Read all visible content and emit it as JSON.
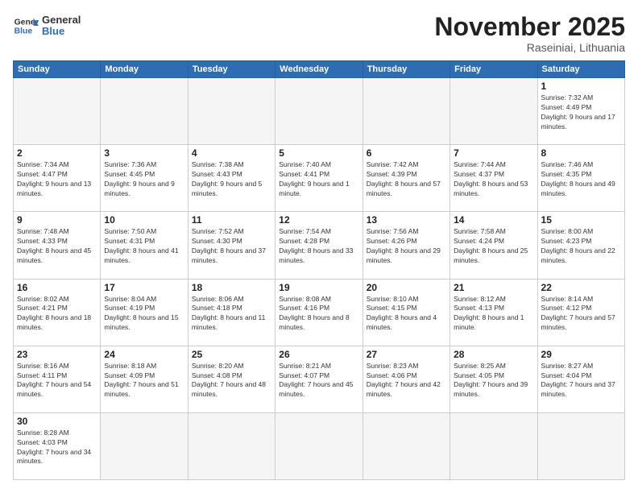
{
  "header": {
    "logo_general": "General",
    "logo_blue": "Blue",
    "month_title": "November 2025",
    "location": "Raseiniai, Lithuania"
  },
  "weekdays": [
    "Sunday",
    "Monday",
    "Tuesday",
    "Wednesday",
    "Thursday",
    "Friday",
    "Saturday"
  ],
  "days": [
    {
      "num": "",
      "info": ""
    },
    {
      "num": "",
      "info": ""
    },
    {
      "num": "",
      "info": ""
    },
    {
      "num": "",
      "info": ""
    },
    {
      "num": "",
      "info": ""
    },
    {
      "num": "",
      "info": ""
    },
    {
      "num": "1",
      "info": "Sunrise: 7:32 AM\nSunset: 4:49 PM\nDaylight: 9 hours and 17 minutes."
    },
    {
      "num": "2",
      "info": "Sunrise: 7:34 AM\nSunset: 4:47 PM\nDaylight: 9 hours and 13 minutes."
    },
    {
      "num": "3",
      "info": "Sunrise: 7:36 AM\nSunset: 4:45 PM\nDaylight: 9 hours and 9 minutes."
    },
    {
      "num": "4",
      "info": "Sunrise: 7:38 AM\nSunset: 4:43 PM\nDaylight: 9 hours and 5 minutes."
    },
    {
      "num": "5",
      "info": "Sunrise: 7:40 AM\nSunset: 4:41 PM\nDaylight: 9 hours and 1 minute."
    },
    {
      "num": "6",
      "info": "Sunrise: 7:42 AM\nSunset: 4:39 PM\nDaylight: 8 hours and 57 minutes."
    },
    {
      "num": "7",
      "info": "Sunrise: 7:44 AM\nSunset: 4:37 PM\nDaylight: 8 hours and 53 minutes."
    },
    {
      "num": "8",
      "info": "Sunrise: 7:46 AM\nSunset: 4:35 PM\nDaylight: 8 hours and 49 minutes."
    },
    {
      "num": "9",
      "info": "Sunrise: 7:48 AM\nSunset: 4:33 PM\nDaylight: 8 hours and 45 minutes."
    },
    {
      "num": "10",
      "info": "Sunrise: 7:50 AM\nSunset: 4:31 PM\nDaylight: 8 hours and 41 minutes."
    },
    {
      "num": "11",
      "info": "Sunrise: 7:52 AM\nSunset: 4:30 PM\nDaylight: 8 hours and 37 minutes."
    },
    {
      "num": "12",
      "info": "Sunrise: 7:54 AM\nSunset: 4:28 PM\nDaylight: 8 hours and 33 minutes."
    },
    {
      "num": "13",
      "info": "Sunrise: 7:56 AM\nSunset: 4:26 PM\nDaylight: 8 hours and 29 minutes."
    },
    {
      "num": "14",
      "info": "Sunrise: 7:58 AM\nSunset: 4:24 PM\nDaylight: 8 hours and 25 minutes."
    },
    {
      "num": "15",
      "info": "Sunrise: 8:00 AM\nSunset: 4:23 PM\nDaylight: 8 hours and 22 minutes."
    },
    {
      "num": "16",
      "info": "Sunrise: 8:02 AM\nSunset: 4:21 PM\nDaylight: 8 hours and 18 minutes."
    },
    {
      "num": "17",
      "info": "Sunrise: 8:04 AM\nSunset: 4:19 PM\nDaylight: 8 hours and 15 minutes."
    },
    {
      "num": "18",
      "info": "Sunrise: 8:06 AM\nSunset: 4:18 PM\nDaylight: 8 hours and 11 minutes."
    },
    {
      "num": "19",
      "info": "Sunrise: 8:08 AM\nSunset: 4:16 PM\nDaylight: 8 hours and 8 minutes."
    },
    {
      "num": "20",
      "info": "Sunrise: 8:10 AM\nSunset: 4:15 PM\nDaylight: 8 hours and 4 minutes."
    },
    {
      "num": "21",
      "info": "Sunrise: 8:12 AM\nSunset: 4:13 PM\nDaylight: 8 hours and 1 minute."
    },
    {
      "num": "22",
      "info": "Sunrise: 8:14 AM\nSunset: 4:12 PM\nDaylight: 7 hours and 57 minutes."
    },
    {
      "num": "23",
      "info": "Sunrise: 8:16 AM\nSunset: 4:11 PM\nDaylight: 7 hours and 54 minutes."
    },
    {
      "num": "24",
      "info": "Sunrise: 8:18 AM\nSunset: 4:09 PM\nDaylight: 7 hours and 51 minutes."
    },
    {
      "num": "25",
      "info": "Sunrise: 8:20 AM\nSunset: 4:08 PM\nDaylight: 7 hours and 48 minutes."
    },
    {
      "num": "26",
      "info": "Sunrise: 8:21 AM\nSunset: 4:07 PM\nDaylight: 7 hours and 45 minutes."
    },
    {
      "num": "27",
      "info": "Sunrise: 8:23 AM\nSunset: 4:06 PM\nDaylight: 7 hours and 42 minutes."
    },
    {
      "num": "28",
      "info": "Sunrise: 8:25 AM\nSunset: 4:05 PM\nDaylight: 7 hours and 39 minutes."
    },
    {
      "num": "29",
      "info": "Sunrise: 8:27 AM\nSunset: 4:04 PM\nDaylight: 7 hours and 37 minutes."
    },
    {
      "num": "30",
      "info": "Sunrise: 8:28 AM\nSunset: 4:03 PM\nDaylight: 7 hours and 34 minutes."
    },
    {
      "num": "",
      "info": ""
    },
    {
      "num": "",
      "info": ""
    },
    {
      "num": "",
      "info": ""
    },
    {
      "num": "",
      "info": ""
    },
    {
      "num": "",
      "info": ""
    }
  ]
}
